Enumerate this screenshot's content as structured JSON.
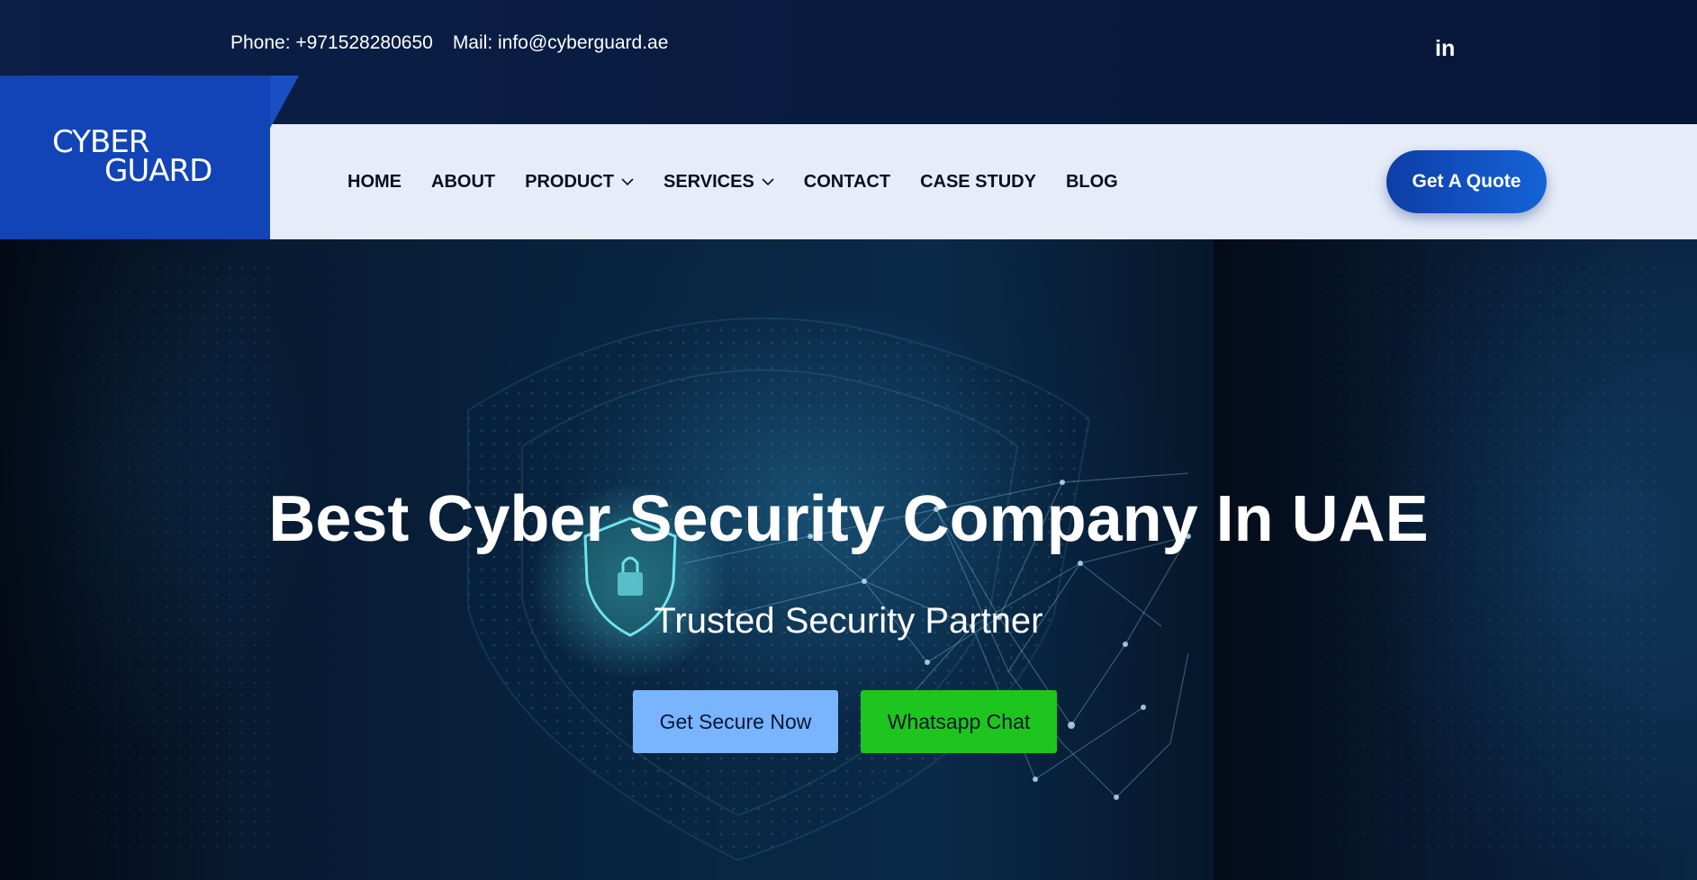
{
  "topbar": {
    "phone": "Phone: +971528280650",
    "mail": "Mail: info@cyberguard.ae",
    "linkedin_icon": "linkedin-icon",
    "linkedin_label": "in"
  },
  "logo": {
    "line1": "CYBER",
    "line2": "GUARD"
  },
  "nav": {
    "items": [
      {
        "label": "HOME"
      },
      {
        "label": "ABOUT"
      },
      {
        "label": "PRODUCT",
        "dropdown": true
      },
      {
        "label": "SERVICES",
        "dropdown": true
      },
      {
        "label": "CONTACT"
      },
      {
        "label": "CASE STUDY"
      },
      {
        "label": "BLOG"
      }
    ],
    "quote_label": "Get A Quote"
  },
  "hero": {
    "title": "Best Cyber Security Company In UAE",
    "subtitle": "Trusted Security Partner",
    "primary_button": "Get Secure Now",
    "secondary_button": "Whatsapp Chat",
    "background_icon": "shield-lock-icon"
  },
  "colors": {
    "topbar_bg": "#0b1f47",
    "nav_bg": "#e6edf8",
    "logo_bg": "#1244b8",
    "accent": "#1563d8",
    "secure_button": "#78b4ff",
    "whatsapp_button": "#1fc51f"
  }
}
